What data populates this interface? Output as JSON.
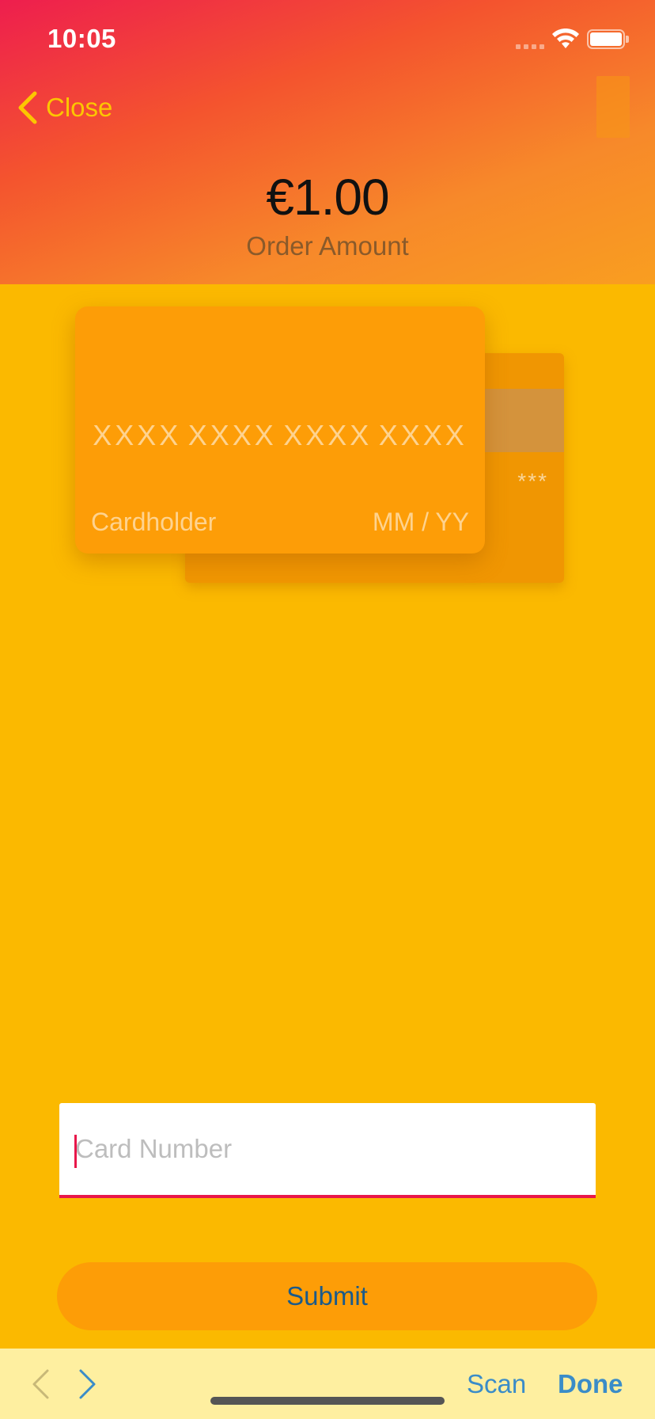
{
  "status_bar": {
    "time": "10:05"
  },
  "header": {
    "close_label": "Close",
    "amount": "€1.00",
    "amount_label": "Order Amount"
  },
  "card_preview": {
    "number_groups": [
      "XXXX",
      "XXXX",
      "XXXX",
      "XXXX"
    ],
    "cardholder_placeholder": "Cardholder",
    "expiry_placeholder": "MM / YY",
    "cvv_placeholder": "***"
  },
  "form": {
    "card_number_placeholder": "Card Number",
    "card_number_value": "",
    "submit_label": "Submit"
  },
  "keyboard_toolbar": {
    "scan_label": "Scan",
    "done_label": "Done"
  },
  "colors": {
    "background": "#FBB900",
    "header_gradient_start": "#EE1E4E",
    "header_gradient_end": "#F99E20",
    "accent_yellow": "#FCC600",
    "card": "#FD9D07",
    "input_underline": "#E8174A",
    "toolbar_link": "#3A8CC8"
  },
  "icons": [
    "chevron-left-icon",
    "signal-icon",
    "wifi-icon",
    "battery-icon",
    "previous-arrow-icon",
    "next-arrow-icon"
  ]
}
